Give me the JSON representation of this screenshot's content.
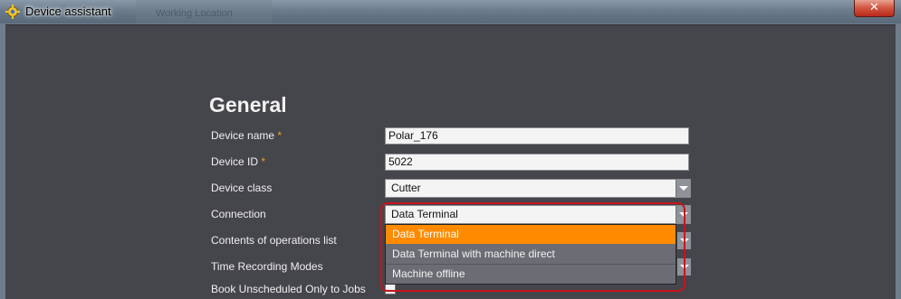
{
  "window": {
    "title": "Device assistant",
    "background_tab": "Working Location",
    "close_symbol": "✕"
  },
  "form": {
    "heading": "General",
    "required_marker": "*",
    "device_name": {
      "label": "Device name",
      "value": "Polar_176"
    },
    "device_id": {
      "label": "Device ID",
      "value": "5022"
    },
    "device_class": {
      "label": "Device class",
      "value": "Cutter"
    },
    "connection": {
      "label": "Connection",
      "value": "Data Terminal",
      "options": [
        "Data Terminal",
        "Data Terminal with machine direct",
        "Machine offline"
      ],
      "selected_index": 0
    },
    "operations_list": {
      "label": "Contents of operations list"
    },
    "time_recording": {
      "label": "Time Recording Modes"
    },
    "book_unscheduled": {
      "label": "Book Unscheduled Only to Jobs",
      "checked": false
    }
  },
  "colors": {
    "accent_selected": "#ff8a00",
    "highlight_border": "#c8141e",
    "required_marker": "#f0a020",
    "panel_background": "#45454c"
  },
  "icons": [
    "app-gear-icon",
    "close-icon",
    "chevron-down-icon"
  ]
}
